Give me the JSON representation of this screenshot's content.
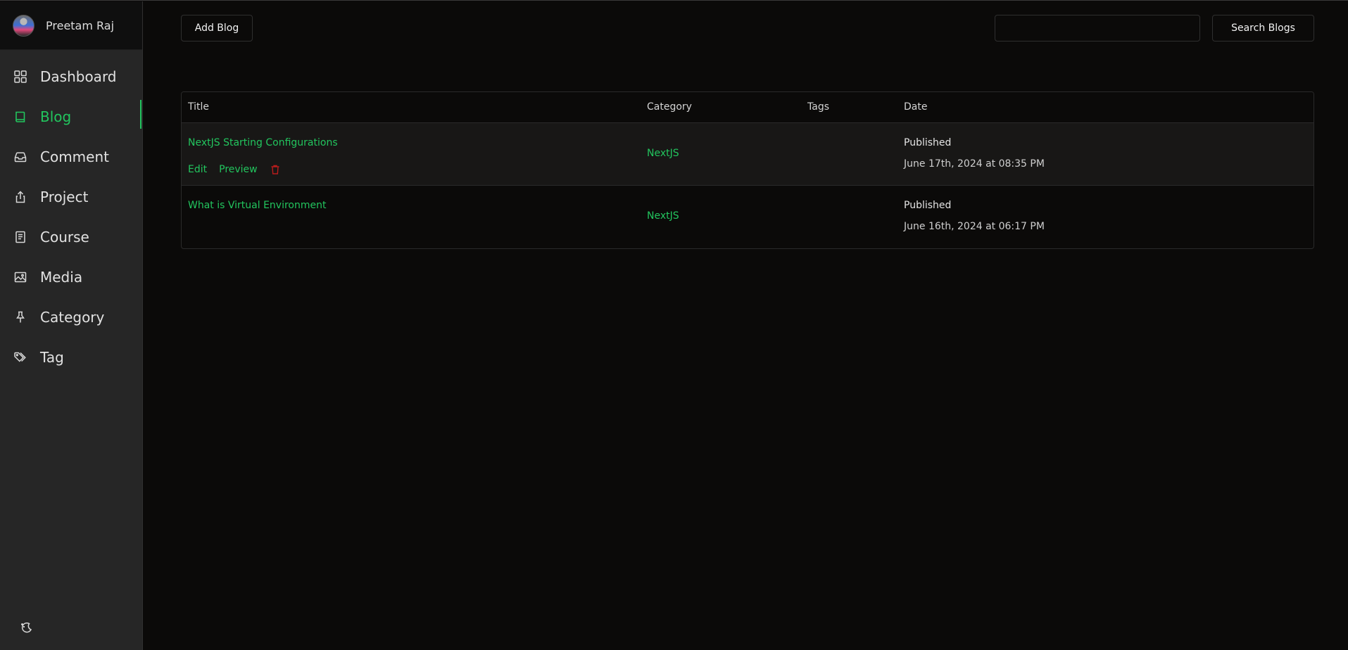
{
  "profile": {
    "name": "Preetam Raj"
  },
  "sidebar": {
    "items": [
      {
        "label": "Dashboard",
        "icon": "dashboard-grid-icon",
        "active": false
      },
      {
        "label": "Blog",
        "icon": "book-icon",
        "active": true
      },
      {
        "label": "Comment",
        "icon": "inbox-icon",
        "active": false
      },
      {
        "label": "Project",
        "icon": "upload-share-icon",
        "active": false
      },
      {
        "label": "Course",
        "icon": "document-icon",
        "active": false
      },
      {
        "label": "Media",
        "icon": "image-icon",
        "active": false
      },
      {
        "label": "Category",
        "icon": "pin-icon",
        "active": false
      },
      {
        "label": "Tag",
        "icon": "tags-icon",
        "active": false
      }
    ],
    "theme_toggle_icon": "moon-sun-icon"
  },
  "toolbar": {
    "add_label": "Add Blog",
    "search_placeholder": "",
    "search_value": "",
    "search_label": "Search Blogs"
  },
  "table": {
    "headers": {
      "title": "Title",
      "category": "Category",
      "tags": "Tags",
      "date": "Date"
    },
    "rows": [
      {
        "title": "NextJS Starting Configurations",
        "category": "NextJS",
        "tags": "",
        "status": "Published",
        "date": "June 17th, 2024 at 08:35 PM",
        "actions": {
          "edit": "Edit",
          "preview": "Preview"
        }
      },
      {
        "title": "What is Virtual Environment",
        "category": "NextJS",
        "tags": "",
        "status": "Published",
        "date": "June 16th, 2024 at 06:17 PM"
      }
    ]
  },
  "colors": {
    "accent": "#22c55e",
    "danger": "#b91c1c",
    "background": "#0b0a09",
    "sidebar": "#262626"
  }
}
